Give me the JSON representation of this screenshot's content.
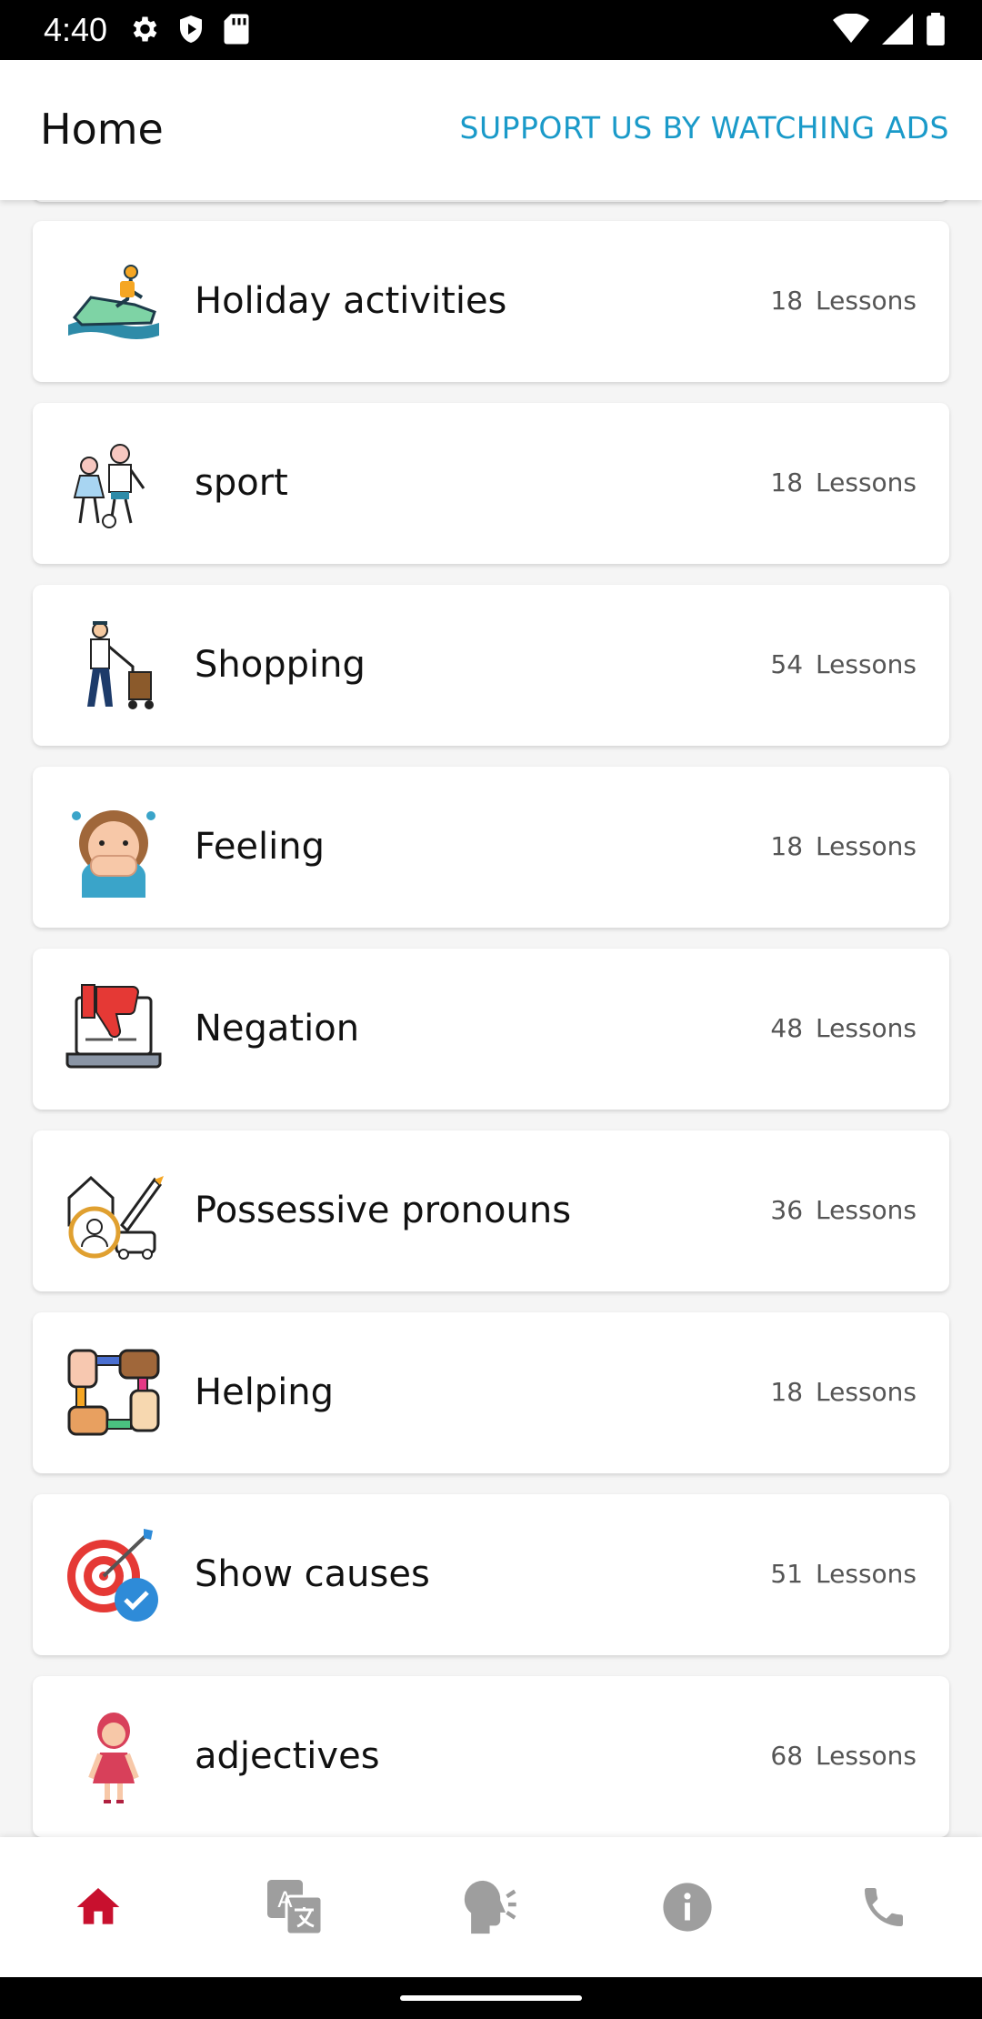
{
  "status_bar": {
    "time": "4:40",
    "icons_left": [
      "gear-icon",
      "shield-play-icon",
      "sd-card-icon"
    ],
    "icons_right": [
      "wifi-icon",
      "signal-icon",
      "battery-icon"
    ]
  },
  "app_bar": {
    "title": "Home",
    "action_label": "SUPPORT US BY WATCHING ADS",
    "accent_color": "#1a9ac9"
  },
  "lessons": [
    {
      "title": "Holiday activities",
      "count": "18",
      "unit": "Lessons",
      "icon": "jet-ski-icon"
    },
    {
      "title": "sport",
      "count": "18",
      "unit": "Lessons",
      "icon": "kids-playing-ball-icon"
    },
    {
      "title": "Shopping",
      "count": "54",
      "unit": "Lessons",
      "icon": "delivery-man-trolley-icon"
    },
    {
      "title": "Feeling",
      "count": "18",
      "unit": "Lessons",
      "icon": "embarrassed-girl-icon"
    },
    {
      "title": "Negation",
      "count": "48",
      "unit": "Lessons",
      "icon": "thumbs-down-laptop-icon"
    },
    {
      "title": "Possessive pronouns",
      "count": "36",
      "unit": "Lessons",
      "icon": "house-person-car-icon"
    },
    {
      "title": "Helping",
      "count": "18",
      "unit": "Lessons",
      "icon": "hands-helping-icon"
    },
    {
      "title": "Show causes",
      "count": "51",
      "unit": "Lessons",
      "icon": "target-check-icon"
    },
    {
      "title": "adjectives",
      "count": "68",
      "unit": "Lessons",
      "icon": "girl-red-dress-icon"
    }
  ],
  "bottom_nav": {
    "items": [
      "home-icon",
      "translate-icon",
      "speaking-head-icon",
      "info-icon",
      "phone-icon"
    ],
    "active": "home-icon",
    "active_color": "#c8102e",
    "inactive_color": "#9e9e9e"
  }
}
